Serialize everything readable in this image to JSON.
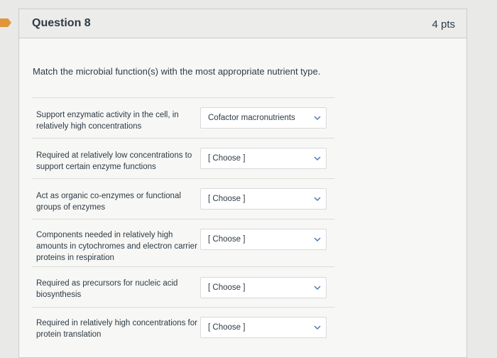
{
  "question": {
    "title": "Question 8",
    "points": "4 pts",
    "prompt": "Match the microbial function(s) with the most appropriate nutrient type."
  },
  "rows": [
    {
      "label": "Support enzymatic activity in the cell, in relatively high concentrations",
      "selected": "Cofactor macronutrients"
    },
    {
      "label": "Required at relatively low concentrations to support certain enzyme functions",
      "selected": "[ Choose ]"
    },
    {
      "label": "Act as organic co-enzymes or functional groups of enzymes",
      "selected": "[ Choose ]"
    },
    {
      "label": "Components needed in relatively high amounts in cytochromes and electron carrier proteins in respiration",
      "selected": "[ Choose ]"
    },
    {
      "label": "Required as precursors for nucleic acid biosynthesis",
      "selected": "[ Choose ]"
    },
    {
      "label": "Required in relatively high concentrations for protein translation",
      "selected": "[ Choose ]"
    }
  ],
  "icons": {
    "flag": "bookmark-flag-icon",
    "chevron": "chevron-down-icon"
  },
  "colors": {
    "flag": "#e0953a",
    "text": "#2d3b45",
    "chevron": "#4a78b5"
  }
}
